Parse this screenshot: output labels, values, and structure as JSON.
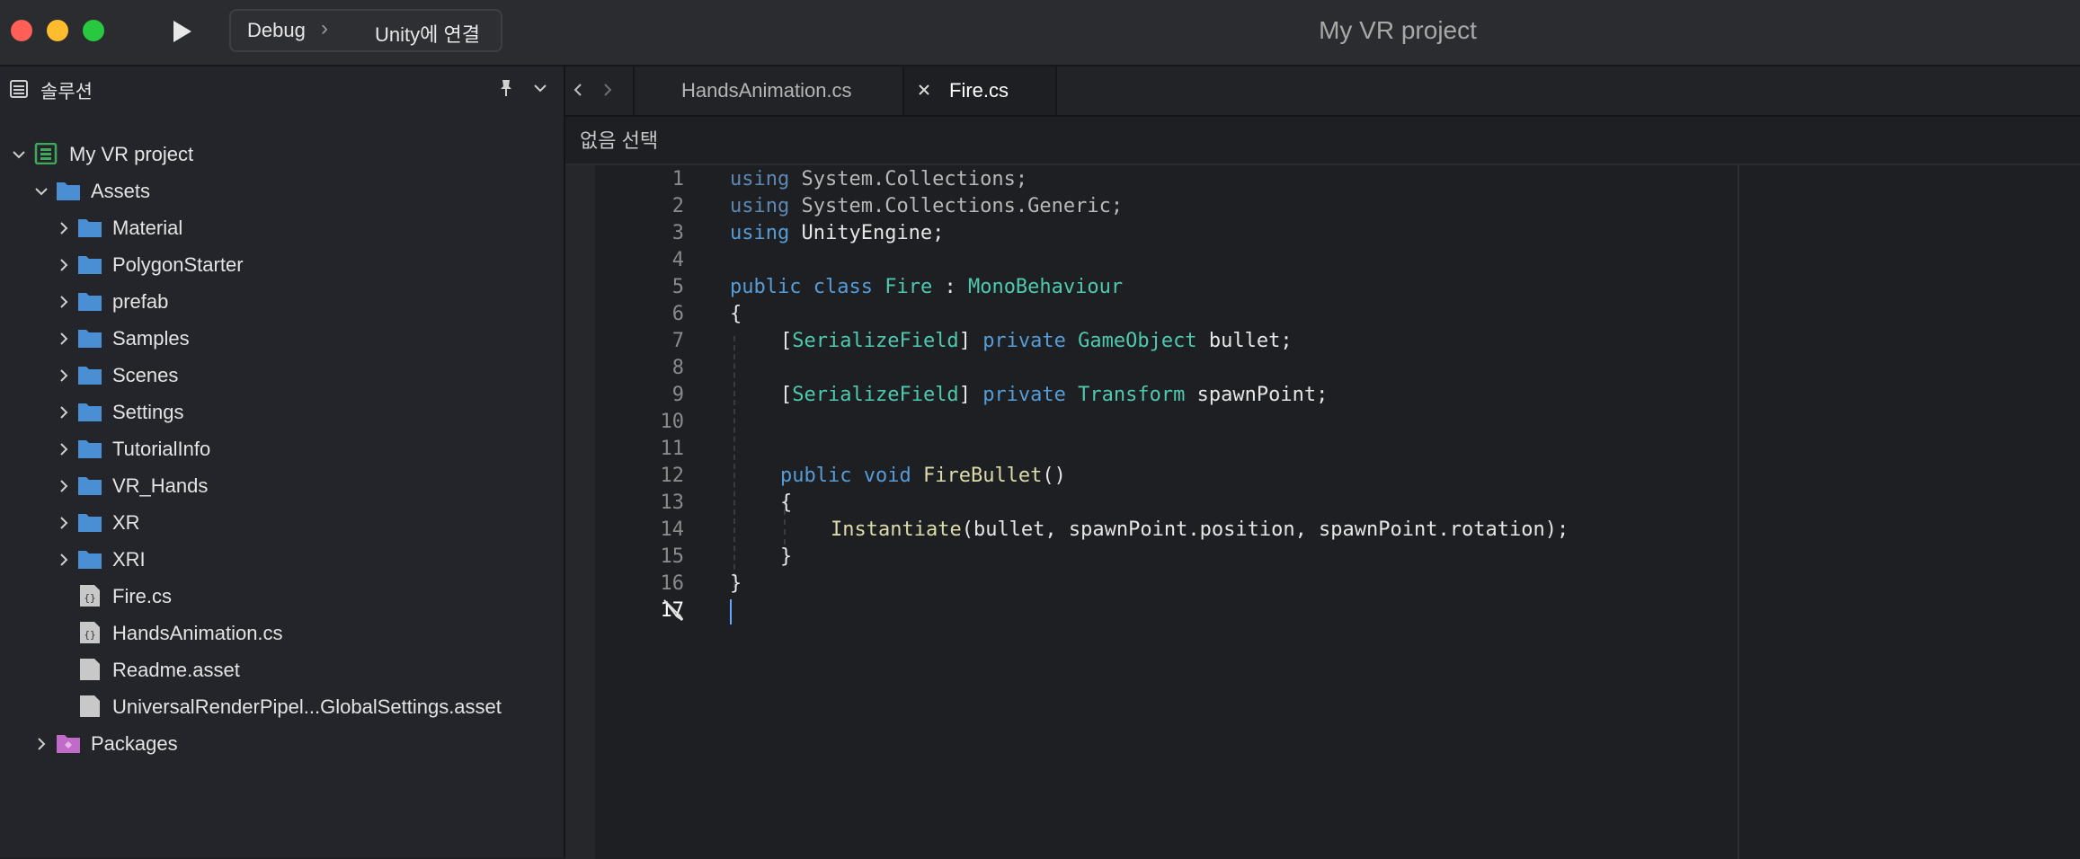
{
  "window": {
    "title": "My VR project",
    "config_name": "Debug",
    "config_separator": "›",
    "run_target": "Unity에 연결"
  },
  "sidebar": {
    "title": "솔루션",
    "items": [
      {
        "label": "My VR project",
        "type": "solution",
        "level": 0,
        "expanded": true
      },
      {
        "label": "Assets",
        "type": "folder",
        "level": 1,
        "expanded": true
      },
      {
        "label": "Material",
        "type": "folder",
        "level": 2,
        "expanded": false
      },
      {
        "label": "PolygonStarter",
        "type": "folder",
        "level": 2,
        "expanded": false
      },
      {
        "label": "prefab",
        "type": "folder",
        "level": 2,
        "expanded": false
      },
      {
        "label": "Samples",
        "type": "folder",
        "level": 2,
        "expanded": false
      },
      {
        "label": "Scenes",
        "type": "folder",
        "level": 2,
        "expanded": false
      },
      {
        "label": "Settings",
        "type": "folder",
        "level": 2,
        "expanded": false
      },
      {
        "label": "TutorialInfo",
        "type": "folder",
        "level": 2,
        "expanded": false
      },
      {
        "label": "VR_Hands",
        "type": "folder",
        "level": 2,
        "expanded": false
      },
      {
        "label": "XR",
        "type": "folder",
        "level": 2,
        "expanded": false
      },
      {
        "label": "XRI",
        "type": "folder",
        "level": 2,
        "expanded": false
      },
      {
        "label": "Fire.cs",
        "type": "csfile",
        "level": 2
      },
      {
        "label": "HandsAnimation.cs",
        "type": "csfile",
        "level": 2
      },
      {
        "label": "Readme.asset",
        "type": "file",
        "level": 2
      },
      {
        "label": "UniversalRenderPipel...GlobalSettings.asset",
        "type": "file",
        "level": 2
      },
      {
        "label": "Packages",
        "type": "package",
        "level": 1,
        "expanded": false
      }
    ]
  },
  "editor": {
    "tabs": [
      {
        "label": "HandsAnimation.cs",
        "active": false
      },
      {
        "label": "Fire.cs",
        "active": true
      }
    ],
    "breadcrumb": "없음 선택",
    "line_numbers": [
      "1",
      "2",
      "3",
      "4",
      "5",
      "6",
      "7",
      "8",
      "9",
      "10",
      "11",
      "12",
      "13",
      "14",
      "15",
      "16",
      "17"
    ],
    "current_line": "17",
    "code": {
      "l1_kw": "using",
      "l1_rest": " System.Collections;",
      "l2_kw": "using",
      "l2_rest": " System.Collections.Generic;",
      "l3_kw": "using",
      "l3_rest": " UnityEngine;",
      "l5_kw1": "public",
      "l5_kw2": "class",
      "l5_name": "Fire",
      "l5_colon": " : ",
      "l5_base": "MonoBehaviour",
      "l6": "{",
      "l7_open": "[",
      "l7_attr": "SerializeField",
      "l7_close": "] ",
      "l7_kw": "private",
      "l7_type": "GameObject",
      "l7_rest": " bullet;",
      "l9_open": "[",
      "l9_attr": "SerializeField",
      "l9_close": "] ",
      "l9_kw": "private",
      "l9_type": "Transform",
      "l9_rest": " spawnPoint;",
      "l12_kw1": "public",
      "l12_kw2": "void",
      "l12_fn": "FireBullet",
      "l12_rest": "()",
      "l13": "{",
      "l14_fn": "Instantiate",
      "l14_rest": "(bullet, spawnPoint.position, spawnPoint.rotation);",
      "l15": "}",
      "l16": "}"
    }
  },
  "colors": {
    "keyword": "#569cd6",
    "type": "#4ec9b0",
    "function": "#dcdcaa",
    "folder": "#4a8fd4",
    "solution_icon": "#3fa85a",
    "package_icon": "#c06bc7"
  },
  "icons": [
    "play-icon",
    "solution-panel-icon",
    "pin-icon",
    "chevron-down-icon",
    "folder-icon",
    "cs-file-icon",
    "file-icon",
    "package-icon",
    "close-icon",
    "nav-back-icon",
    "nav-forward-icon",
    "pen-cursor-icon"
  ]
}
